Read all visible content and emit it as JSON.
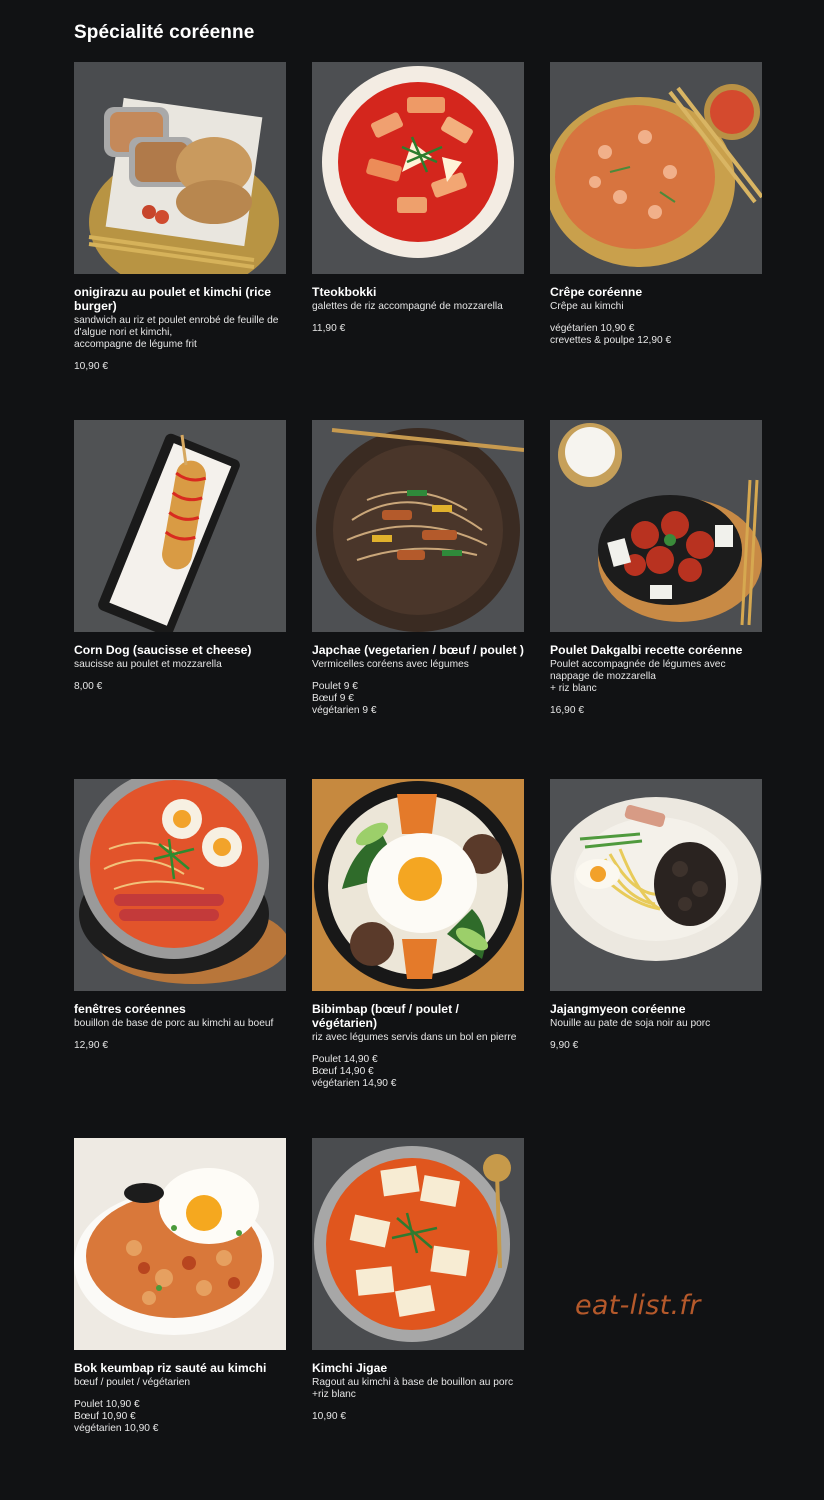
{
  "section": {
    "title": "Spécialité coréenne"
  },
  "watermark": "eat-list.fr",
  "dishes": [
    {
      "name": "onigirazu au poulet et kimchi (rice burger)",
      "description": "sandwich au riz et poulet enrobé de feuille de d'algue nori et kimchi,\naccompagne de légume frit",
      "prices": [
        "10,90 €"
      ],
      "photo": "onigirazu-photo"
    },
    {
      "name": "Tteokbokki",
      "description": "galettes de riz accompagné de mozzarella",
      "prices": [
        "11,90 €"
      ],
      "photo": "tteokbokki-photo"
    },
    {
      "name": "Crêpe coréenne",
      "description": "Crêpe au kimchi",
      "prices": [
        "végétarien 10,90 €",
        "crevettes & poulpe 12,90 €"
      ],
      "photo": "crepe-photo"
    },
    {
      "name": "Corn Dog (saucisse et cheese)",
      "description": "saucisse au poulet et mozzarella",
      "prices": [
        "8,00 €"
      ],
      "photo": "corn-dog-photo"
    },
    {
      "name": "Japchae (vegetarien / bœuf / poulet )",
      "description": "Vermicelles coréens avec légumes",
      "prices": [
        "Poulet 9 €",
        "Bœuf 9 €",
        "végétarien 9 €"
      ],
      "photo": "japchae-photo"
    },
    {
      "name": "Poulet Dakgalbi recette coréenne",
      "description": "Poulet accompagnée de légumes avec nappage de mozzarella\n+ riz blanc",
      "prices": [
        "16,90 €"
      ],
      "photo": "dakgalbi-photo"
    },
    {
      "name": "fenêtres coréennes",
      "description": "bouillon de base de porc au kimchi au boeuf",
      "prices": [
        "12,90 €"
      ],
      "photo": "ramen-photo"
    },
    {
      "name": "Bibimbap (bœuf / poulet / végétarien)",
      "description": "riz avec légumes servis dans un bol en pierre",
      "prices": [
        "Poulet 14,90 €",
        "Bœuf 14,90 €",
        "végétarien 14,90 €"
      ],
      "photo": "bibimbap-photo"
    },
    {
      "name": "Jajangmyeon coréenne",
      "description": "Nouille au pate de soja noir au porc",
      "prices": [
        "9,90 €"
      ],
      "photo": "jajangmyeon-photo"
    },
    {
      "name": "Bok keumbap riz sauté au kimchi",
      "description": "bœuf / poulet / végétarien",
      "prices": [
        "Poulet 10,90 €",
        "Bœuf 10,90 €",
        "végétarien 10,90 €"
      ],
      "photo": "kimchi-fried-rice-photo"
    },
    {
      "name": "Kimchi Jigae",
      "description": "Ragout au kimchi à base de bouillon au porc\n+riz blanc",
      "prices": [
        "10,90 €"
      ],
      "photo": "kimchi-jigae-photo"
    }
  ]
}
